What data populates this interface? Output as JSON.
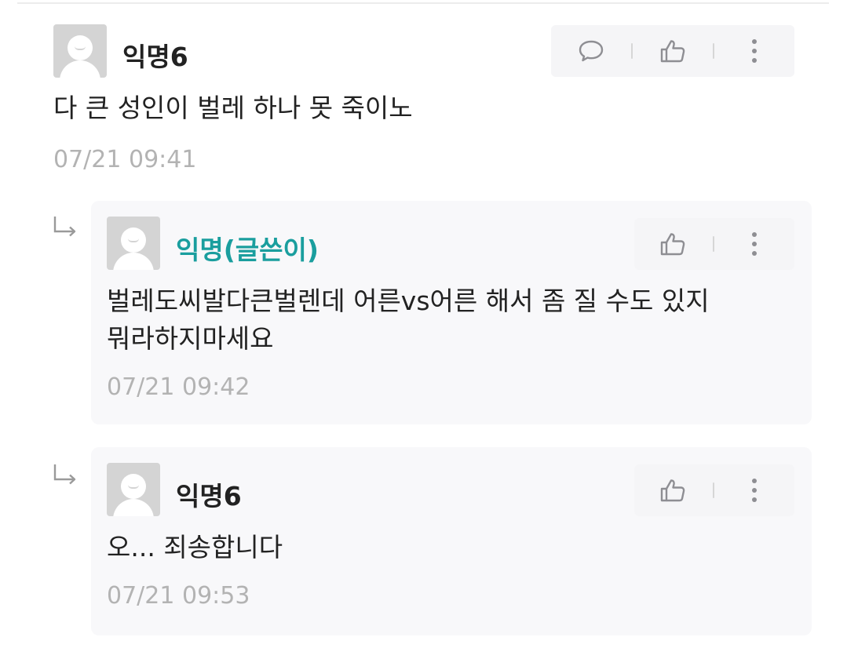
{
  "comments": [
    {
      "nickname": "익명6",
      "text": "다 큰 성인이 벌레 하나 못 죽이노",
      "timestamp": "07/21 09:41",
      "actions": [
        "reply-icon",
        "like-icon",
        "more-icon"
      ]
    }
  ],
  "replies": [
    {
      "nickname": "익명(글쓴이)",
      "is_author": true,
      "text_line1": "벌레도씨발다큰벌렌데 어른vs어른 해서 좀 질 수도 있지",
      "text_line2": "뭐라하지마세요",
      "timestamp": "07/21 09:42",
      "actions": [
        "like-icon",
        "more-icon"
      ]
    },
    {
      "nickname": "익명6",
      "is_author": false,
      "text_line1": "오... 죄송합니다",
      "timestamp": "07/21 09:53",
      "actions": [
        "like-icon",
        "more-icon"
      ]
    }
  ],
  "colors": {
    "author_nickname": "#1a9e9e",
    "text": "#222222",
    "timestamp": "#b3b3b3",
    "icon": "#8e8e93",
    "reply_card_bg": "#f8f8fa",
    "action_bar_bg": "#f5f5f7"
  }
}
